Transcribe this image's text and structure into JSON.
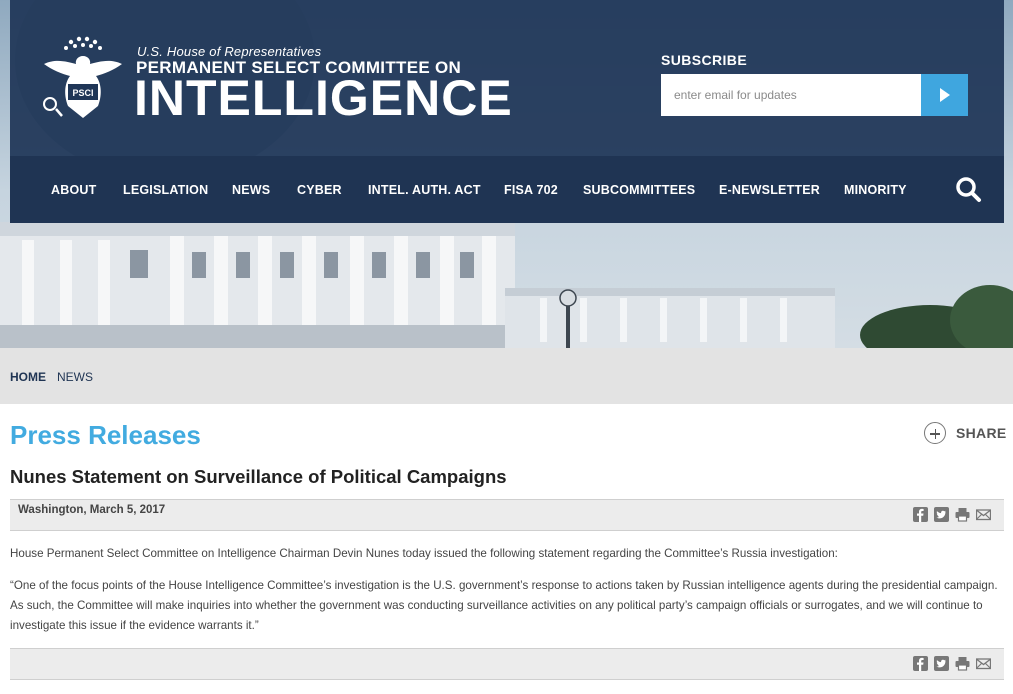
{
  "header": {
    "house_line": "U.S. House of Representatives",
    "committee_line": "PERMANENT SELECT COMMITTEE ON",
    "intel_line": "INTELLIGENCE",
    "seal_icon": "house-intelligence-eagle-seal"
  },
  "subscribe": {
    "label": "SUBSCRIBE",
    "placeholder": "enter email for updates",
    "button_icon": "play-arrow-icon",
    "button_color": "#3fa6df"
  },
  "nav": {
    "items": [
      {
        "label": "ABOUT"
      },
      {
        "label": "LEGISLATION"
      },
      {
        "label": "NEWS"
      },
      {
        "label": "CYBER"
      },
      {
        "label": "INTEL. AUTH. ACT"
      },
      {
        "label": "FISA 702"
      },
      {
        "label": "SUBCOMMITTEES"
      },
      {
        "label": "E-NEWSLETTER"
      },
      {
        "label": "MINORITY"
      }
    ],
    "search_icon": "search-icon"
  },
  "breadcrumb": {
    "home": "HOME",
    "news": "NEWS"
  },
  "main": {
    "page_title": "Press Releases",
    "share_label": "SHARE",
    "article_title": "Nunes Statement on Surveillance of Political Campaigns",
    "dateline": "Washington, March 5, 2017",
    "paragraphs": [
      "House Permanent Select Committee on Intelligence Chairman Devin Nunes today issued the following statement regarding the Committee’s Russia investigation:",
      "“One of the focus points of the House Intelligence Committee’s investigation is the U.S. government’s response to actions taken by Russian intelligence agents during the presidential campaign. As such, the Committee will make inquiries into whether the government was conducting surveillance activities on any political party’s campaign officials or surrogates, and we will continue to investigate this issue if the evidence warrants it.”"
    ],
    "tool_icons": [
      "facebook-icon",
      "twitter-icon",
      "print-icon",
      "email-icon"
    ]
  },
  "colors": {
    "header_bg": "#1f3657",
    "nav_bg": "#1f3453",
    "title_blue": "#42abe0"
  }
}
